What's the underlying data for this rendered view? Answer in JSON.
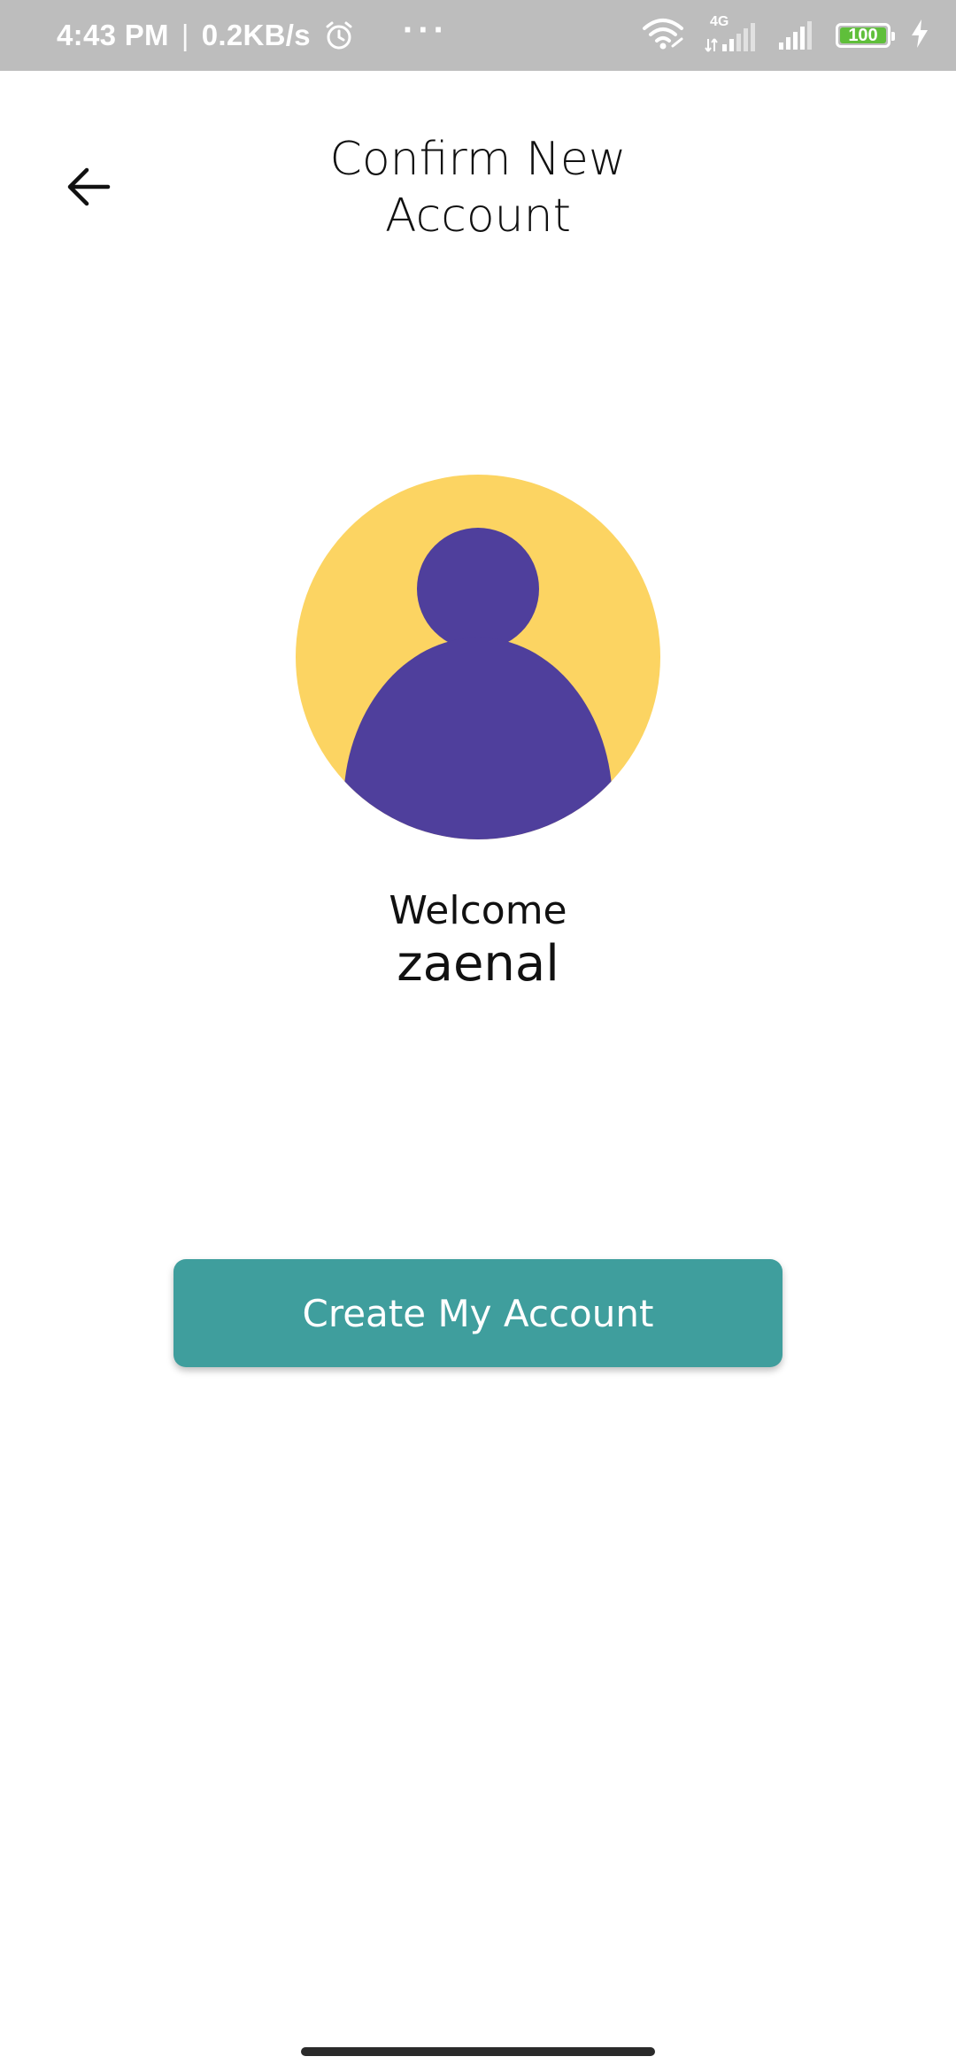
{
  "status_bar": {
    "time": "4:43 PM",
    "separator": "|",
    "net_speed": "0.2KB/s",
    "more_dots": "···",
    "network_label": "4G",
    "battery_level": "100",
    "icons": [
      "alarm-icon",
      "wifi-icon",
      "signal-4g-icon",
      "signal-icon",
      "battery-icon",
      "charging-icon"
    ]
  },
  "header": {
    "title": "Confirm New Account",
    "back_icon": "arrow-left-icon"
  },
  "profile": {
    "avatar_icon": "user-avatar-icon",
    "welcome_label": "Welcome",
    "username": "zaenal"
  },
  "actions": {
    "create_account_label": "Create My Account"
  },
  "colors": {
    "status_bar_bg": "#bdbdbd",
    "avatar_bg": "#fcd462",
    "avatar_figure": "#4f3f9c",
    "button_bg": "#3f9e9d",
    "button_text": "#ffffff",
    "battery_fill": "#5fbf3a"
  }
}
